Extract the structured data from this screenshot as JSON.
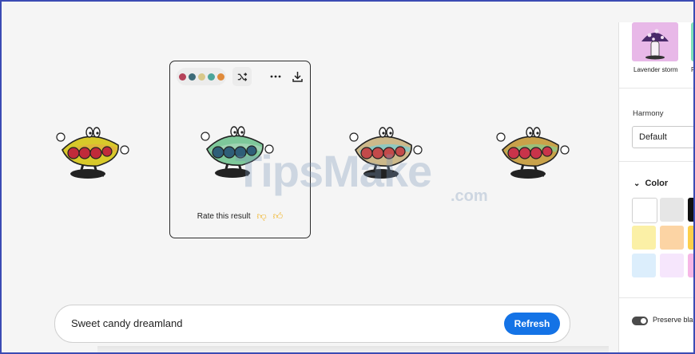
{
  "variations": [
    {
      "id": "v1",
      "colors": [
        "#d8c92a",
        "#c02a3a",
        "#e0b43a"
      ]
    },
    {
      "id": "v2",
      "colors": [
        "#7ec89a",
        "#2f5e78",
        "#9fd3b2"
      ]
    },
    {
      "id": "v3",
      "colors": [
        "#cdb98a",
        "#c34a4a",
        "#8fc8c0"
      ]
    },
    {
      "id": "v4",
      "colors": [
        "#c9a24a",
        "#c9344a",
        "#9ac07a"
      ]
    }
  ],
  "selected_card": {
    "palette": [
      "#b5435a",
      "#3d6b78",
      "#d8c88a",
      "#4ca59a",
      "#e08a3a"
    ],
    "shuffle_icon": "shuffle-icon",
    "more_icon": "more-icon",
    "download_icon": "download-icon",
    "rate_label": "Rate this result",
    "thumbs_down_icon": "thumbs-down-icon",
    "thumbs_up_icon": "thumbs-up-icon"
  },
  "watermark": {
    "main": "TipsMake",
    "suffix": ".com"
  },
  "prompt": {
    "text": "Sweet candy dreamland",
    "button": "Refresh"
  },
  "panel": {
    "styles": [
      {
        "label": "Lavender storm",
        "color": "#e8b8e8"
      },
      {
        "label": "Fa",
        "color": "#7fe0b8"
      }
    ],
    "harmony_label": "Harmony",
    "harmony_value": "Default",
    "color_label": "Color",
    "swatches": [
      "#ffffff",
      "#e6e6e6",
      "#111111",
      "#fbf0a6",
      "#fcd4a4",
      "#fccf4a",
      "#dceefc",
      "#f6e6fc",
      "#f6b6e6"
    ],
    "toggle_label": "Preserve black"
  }
}
